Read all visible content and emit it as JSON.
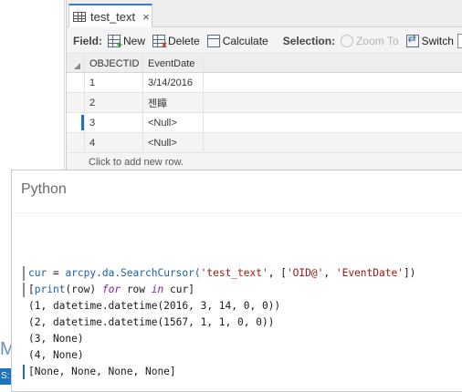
{
  "table_window": {
    "tab": {
      "title": "test_text",
      "close_glyph": "×"
    },
    "toolbar": {
      "field_label": "Field:",
      "new_label": "New",
      "delete_label": "Delete",
      "calculate_label": "Calculate",
      "selection_label": "Selection:",
      "zoom_to_label": "Zoom To",
      "switch_label": "Switch"
    },
    "columns": [
      "OBJECTID",
      "EventDate"
    ],
    "rows": [
      {
        "oid": "1",
        "event_date": "3/14/2016"
      },
      {
        "oid": "2",
        "event_date": "젠瞕"
      },
      {
        "oid": "3",
        "event_date": "<Null>"
      },
      {
        "oid": "4",
        "event_date": "<Null>"
      }
    ],
    "add_row_hint": "Click to add new row."
  },
  "python_window": {
    "title": "Python",
    "lines": [
      {
        "kind": "input",
        "segments": [
          {
            "t": "cur",
            "c": "var"
          },
          {
            "t": " = ",
            "c": "plain"
          },
          {
            "t": "arcpy.da.SearchCursor(",
            "c": "fn"
          },
          {
            "t": "'test_text'",
            "c": "str"
          },
          {
            "t": ", [",
            "c": "plain"
          },
          {
            "t": "'OID@'",
            "c": "str"
          },
          {
            "t": ", ",
            "c": "plain"
          },
          {
            "t": "'EventDate'",
            "c": "str"
          },
          {
            "t": "])",
            "c": "plain"
          }
        ]
      },
      {
        "kind": "input",
        "segments": [
          {
            "t": "[",
            "c": "plain"
          },
          {
            "t": "print",
            "c": "fn"
          },
          {
            "t": "(row) ",
            "c": "plain"
          },
          {
            "t": "for",
            "c": "kw"
          },
          {
            "t": " row ",
            "c": "plain"
          },
          {
            "t": "in",
            "c": "kw"
          },
          {
            "t": " cur]",
            "c": "plain"
          }
        ]
      },
      {
        "kind": "output",
        "segments": [
          {
            "t": "(1, datetime.datetime(2016, 3, 14, 0, 0))",
            "c": "plain"
          }
        ]
      },
      {
        "kind": "output",
        "segments": [
          {
            "t": "(2, datetime.datetime(1567, 1, 1, 0, 0))",
            "c": "plain"
          }
        ]
      },
      {
        "kind": "output",
        "segments": [
          {
            "t": "(3, None)",
            "c": "plain"
          }
        ]
      },
      {
        "kind": "output",
        "segments": [
          {
            "t": "(4, None)",
            "c": "plain"
          }
        ]
      },
      {
        "kind": "result",
        "segments": [
          {
            "t": "[None, None, None, None]",
            "c": "plain"
          }
        ]
      }
    ]
  },
  "background": {
    "partial_text": "M",
    "status_partial": "S:"
  },
  "colors": {
    "accent": "#1e73be",
    "string": "#a31515",
    "keyword": "#7b1fa2",
    "identifier": "#1c5fa8"
  }
}
